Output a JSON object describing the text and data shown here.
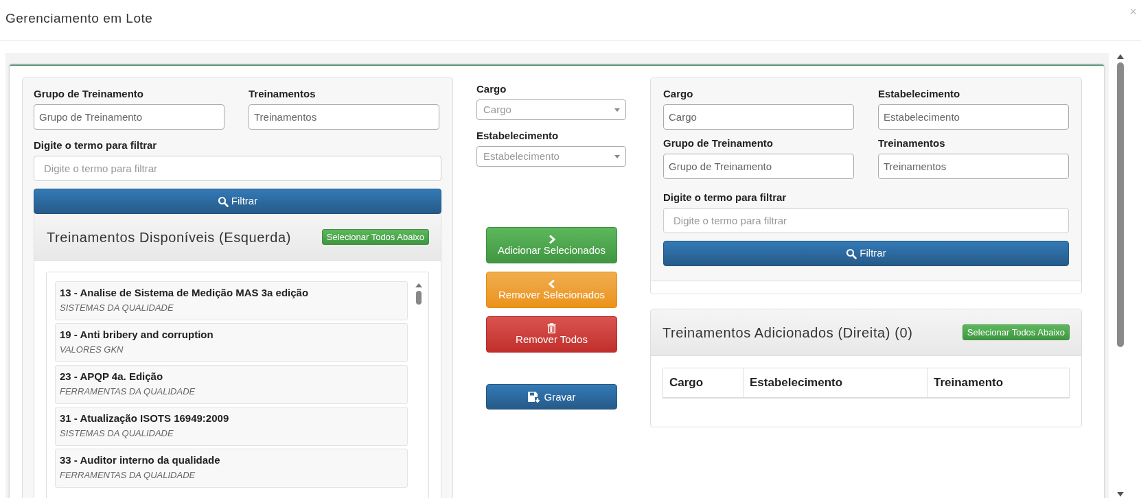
{
  "dialog": {
    "title": "Gerenciamento em Lote",
    "close": "×"
  },
  "left_filter": {
    "fields": [
      {
        "label": "Grupo de Treinamento",
        "placeholder": "Grupo de Treinamento"
      },
      {
        "label": "Treinamentos",
        "placeholder": "Treinamentos"
      }
    ],
    "search": {
      "label": "Digite o termo para filtrar",
      "placeholder": "Digite o termo para filtrar"
    },
    "button": "Filtrar"
  },
  "available": {
    "title": "Treinamentos Disponíveis (Esquerda)",
    "select_all": "Selecionar Todos Abaixo",
    "items": [
      {
        "name": "13 - Analise de Sistema de Medição MAS 3a edição",
        "category": "SISTEMAS DA QUALIDADE"
      },
      {
        "name": "19 - Anti bribery and corruption",
        "category": "VALORES GKN"
      },
      {
        "name": "23 - APQP 4a. Edição",
        "category": "FERRAMENTAS DA QUALIDADE"
      },
      {
        "name": "31 - Atualização ISOTS 16949:2009",
        "category": "SISTEMAS DA QUALIDADE"
      },
      {
        "name": "33 - Auditor interno da qualidade",
        "category": "FERRAMENTAS DA QUALIDADE"
      }
    ]
  },
  "middle": {
    "selects": [
      {
        "label": "Cargo",
        "placeholder": "Cargo"
      },
      {
        "label": "Estabelecimento",
        "placeholder": "Estabelecimento"
      }
    ],
    "actions": [
      {
        "kind": "add",
        "label": "Adicionar Selecionados"
      },
      {
        "kind": "remove",
        "label": "Remover Selecionados"
      },
      {
        "kind": "remove_all",
        "label": "Remover Todos"
      },
      {
        "kind": "save",
        "label": "Gravar"
      }
    ]
  },
  "right_filter": {
    "fields": [
      {
        "label": "Cargo",
        "placeholder": "Cargo"
      },
      {
        "label": "Estabelecimento",
        "placeholder": "Estabelecimento"
      },
      {
        "label": "Grupo de Treinamento",
        "placeholder": "Grupo de Treinamento"
      },
      {
        "label": "Treinamentos",
        "placeholder": "Treinamentos"
      }
    ],
    "search": {
      "label": "Digite o termo para filtrar",
      "placeholder": "Digite o termo para filtrar"
    },
    "button": "Filtrar"
  },
  "added": {
    "title": "Treinamentos Adicionados (Direita) (0)",
    "select_all": "Selecionar Todos Abaixo",
    "columns": [
      "Cargo",
      "Estabelecimento",
      "Treinamento"
    ]
  }
}
